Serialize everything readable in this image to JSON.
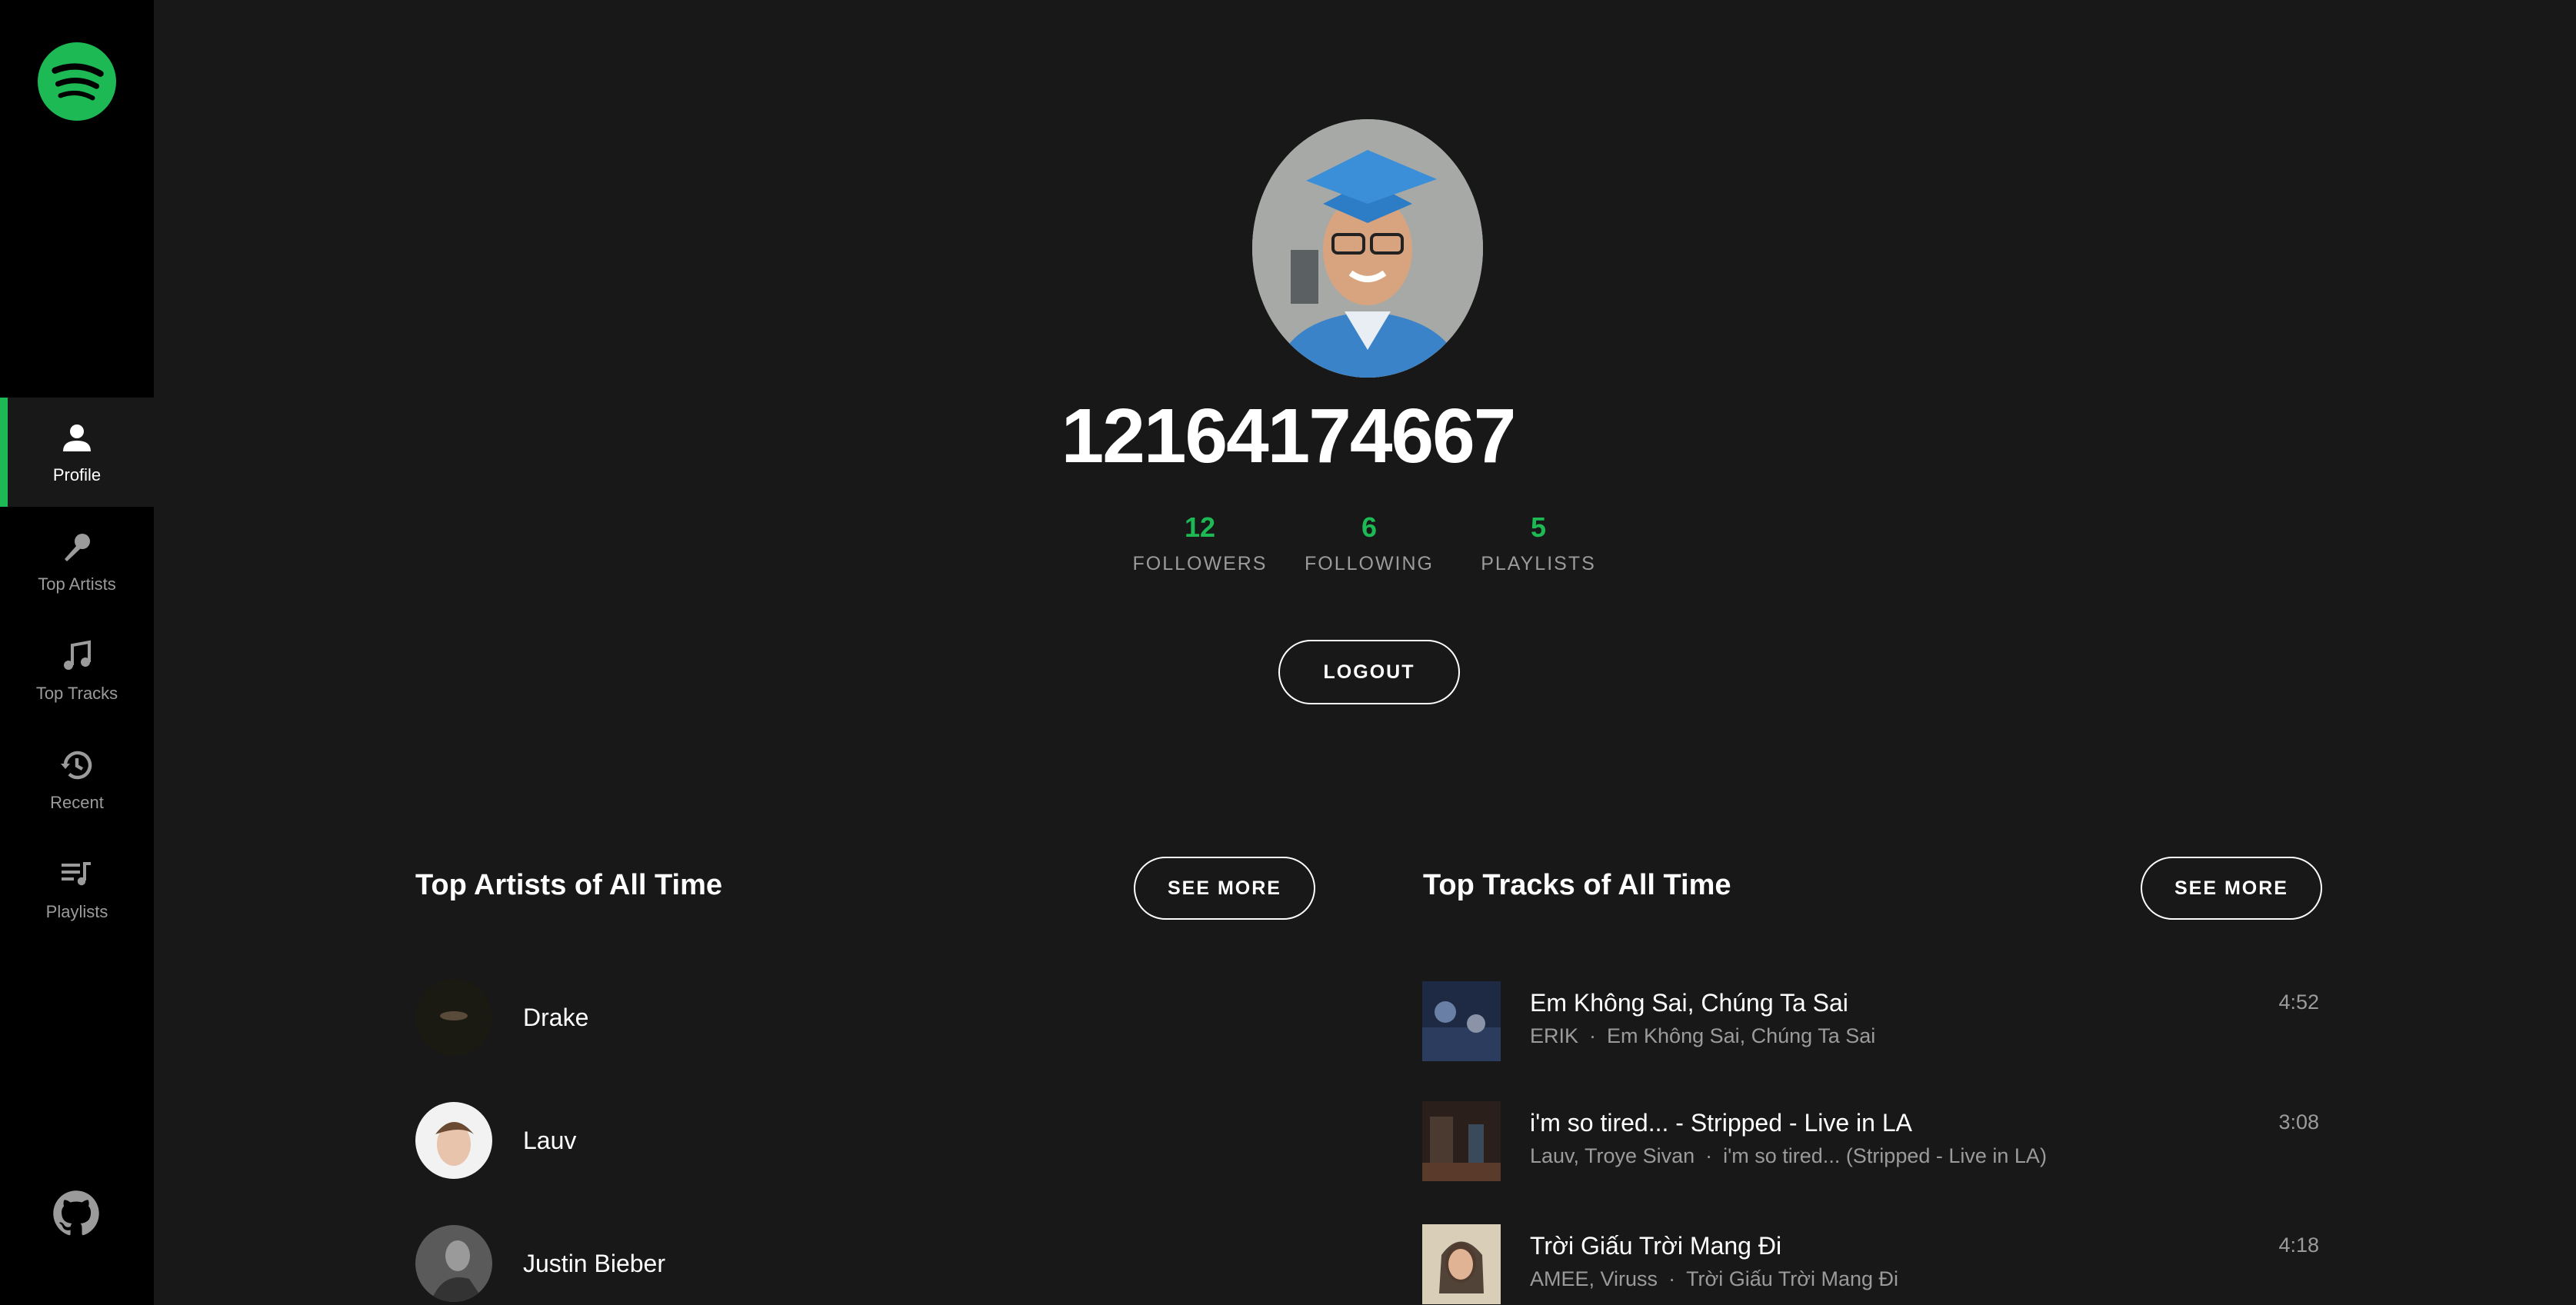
{
  "sidebar": {
    "logo_icon": "spotify-logo-icon",
    "items": [
      {
        "label": "Profile",
        "icon": "user-icon",
        "active": true
      },
      {
        "label": "Top Artists",
        "icon": "microphone-icon",
        "active": false
      },
      {
        "label": "Top Tracks",
        "icon": "music-note-icon",
        "active": false
      },
      {
        "label": "Recent",
        "icon": "history-icon",
        "active": false
      },
      {
        "label": "Playlists",
        "icon": "playlist-icon",
        "active": false
      }
    ],
    "github_icon": "github-icon"
  },
  "profile": {
    "username": "12164174667",
    "stats": [
      {
        "value": "12",
        "label": "FOLLOWERS"
      },
      {
        "value": "6",
        "label": "FOLLOWING"
      },
      {
        "value": "5",
        "label": "PLAYLISTS"
      }
    ],
    "logout_label": "LOGOUT"
  },
  "top_artists": {
    "title": "Top Artists of All Time",
    "see_more": "SEE MORE",
    "items": [
      {
        "name": "Drake"
      },
      {
        "name": "Lauv"
      },
      {
        "name": "Justin Bieber"
      }
    ]
  },
  "top_tracks": {
    "title": "Top Tracks of All Time",
    "see_more": "SEE MORE",
    "items": [
      {
        "name": "Em Không Sai, Chúng Ta Sai",
        "artists": "ERIK",
        "album": "Em Không Sai, Chúng Ta Sai",
        "duration": "4:52"
      },
      {
        "name": "i'm so tired... - Stripped - Live in LA",
        "artists": "Lauv, Troye Sivan",
        "album": "i'm so tired... (Stripped - Live in LA)",
        "duration": "3:08"
      },
      {
        "name": "Trời Giấu Trời Mang Đi",
        "artists": "AMEE, Viruss",
        "album": "Trời Giấu Trời Mang Đi",
        "duration": "4:18"
      }
    ]
  },
  "colors": {
    "accent": "#1db954",
    "background": "#181818",
    "sidebar": "#000000",
    "muted_text": "#9b9b9b"
  }
}
